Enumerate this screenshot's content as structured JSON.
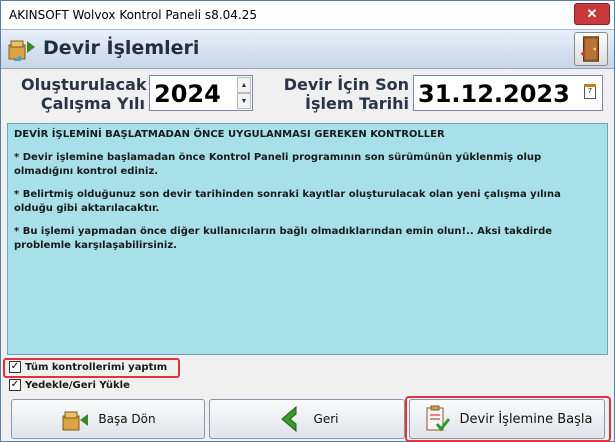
{
  "window": {
    "title": "AKINSOFT Wolvox Kontrol Paneli s8.04.25",
    "close_label": "✕"
  },
  "header": {
    "title": "Devir İşlemleri"
  },
  "form": {
    "year_label": "Oluşturulacak Çalışma Yılı",
    "year_value": "2024",
    "date_label": "Devir İçin Son İşlem Tarihi",
    "date_value": "31.12.2023",
    "calendar_day": "7"
  },
  "info": {
    "heading": "DEVİR İŞLEMİNİ BAŞLATMADAN ÖNCE UYGULANMASI GEREKEN KONTROLLER",
    "items": [
      "* Devir işlemine başlamadan önce Kontrol Paneli programının son sürümünün yüklenmiş olup olmadığını kontrol ediniz.",
      "* Belirtmiş olduğunuz son devir tarihinden sonraki kayıtlar oluşturulacak olan yeni çalışma yılına olduğu gibi aktarılacaktır.",
      "* Bu işlemi yapmadan önce diğer kullanıcıların bağlı olmadıklarından emin olun!.. Aksi takdirde problemle karşılaşabilirsiniz."
    ]
  },
  "checkboxes": {
    "all_checks_label": "Tüm kontrollerimi yaptım",
    "all_checks_checked": true,
    "backup_label": "Yedekle/Geri Yükle",
    "backup_checked": true
  },
  "buttons": {
    "back_label": "Başa Dön",
    "prev_label": "Geri",
    "start_label": "Devir İşlemine Başla"
  },
  "colors": {
    "info_bg": "#a8e0ea",
    "highlight": "#e0323c",
    "close_bg": "#c7393a"
  }
}
